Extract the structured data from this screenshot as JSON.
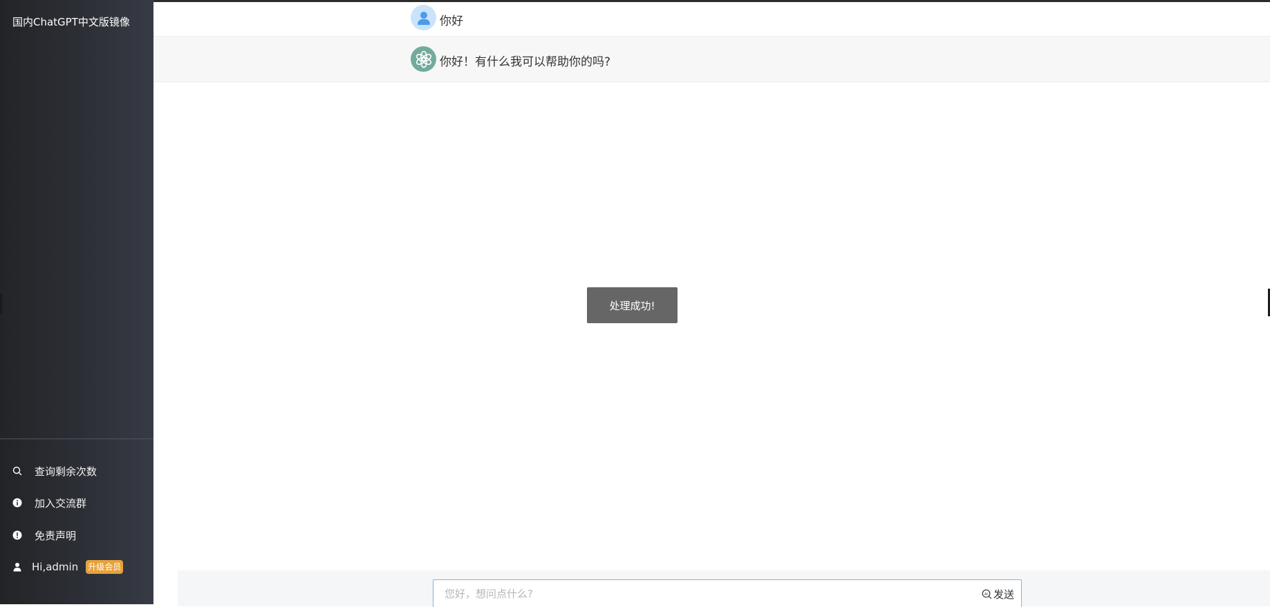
{
  "app": {
    "title": "国内ChatGPT中文版镜像"
  },
  "sidebar": {
    "items": [
      {
        "label": "查询剩余次数",
        "icon": "search-icon"
      },
      {
        "label": "加入交流群",
        "icon": "info-circle-icon"
      },
      {
        "label": "免责声明",
        "icon": "warning-circle-icon"
      },
      {
        "label": "Hi,admin",
        "icon": "user-icon",
        "badge": "升级会员"
      }
    ]
  },
  "chat": {
    "messages": [
      {
        "role": "user",
        "text": "你好"
      },
      {
        "role": "assistant",
        "text": "你好！有什么我可以帮助你的吗?"
      }
    ]
  },
  "toast": {
    "text": "处理成功!"
  },
  "composer": {
    "placeholder": "您好，想问点什么?",
    "send_label": "发送"
  },
  "colors": {
    "sidebar_bg": "#2c2f36",
    "badge": "#e6a23c",
    "toast_bg": "#666666",
    "assistant_avatar": "#74aa9c",
    "user_avatar": "#c9e3fb",
    "input_border": "#7fb3dc"
  }
}
